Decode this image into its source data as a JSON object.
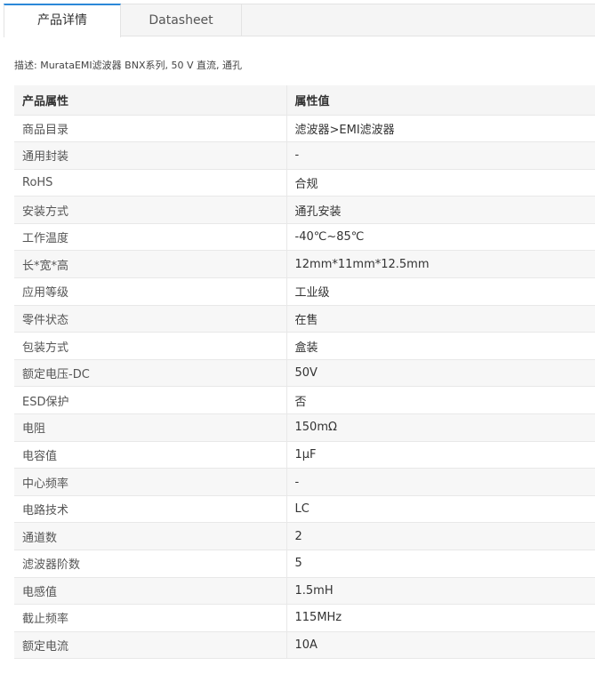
{
  "tabs": [
    {
      "label": "产品详情",
      "active": true
    },
    {
      "label": "Datasheet",
      "active": false
    }
  ],
  "description": "描述:  MurataEMI滤波器 BNX系列, 50 V 直流, 通孔",
  "table": {
    "headers": [
      "产品属性",
      "属性值"
    ],
    "rows": [
      {
        "key": "商品目录",
        "value": "滤波器>EMI滤波器"
      },
      {
        "key": "通用封装",
        "value": "-"
      },
      {
        "key": "RoHS",
        "value": "合规"
      },
      {
        "key": "安装方式",
        "value": "通孔安装"
      },
      {
        "key": "工作温度",
        "value": "-40℃~85℃"
      },
      {
        "key": "长*宽*高",
        "value": "12mm*11mm*12.5mm"
      },
      {
        "key": "应用等级",
        "value": "工业级"
      },
      {
        "key": "零件状态",
        "value": "在售"
      },
      {
        "key": "包装方式",
        "value": "盒装"
      },
      {
        "key": "额定电压-DC",
        "value": "50V"
      },
      {
        "key": "ESD保护",
        "value": "否"
      },
      {
        "key": "电阻",
        "value": "150mΩ"
      },
      {
        "key": "电容值",
        "value": "1μF"
      },
      {
        "key": "中心频率",
        "value": "-"
      },
      {
        "key": "电路技术",
        "value": "LC"
      },
      {
        "key": "通道数",
        "value": "2"
      },
      {
        "key": "滤波器阶数",
        "value": "5"
      },
      {
        "key": "电感值",
        "value": "1.5mH"
      },
      {
        "key": "截止频率",
        "value": "115MHz"
      },
      {
        "key": "额定电流",
        "value": "10A"
      }
    ]
  }
}
